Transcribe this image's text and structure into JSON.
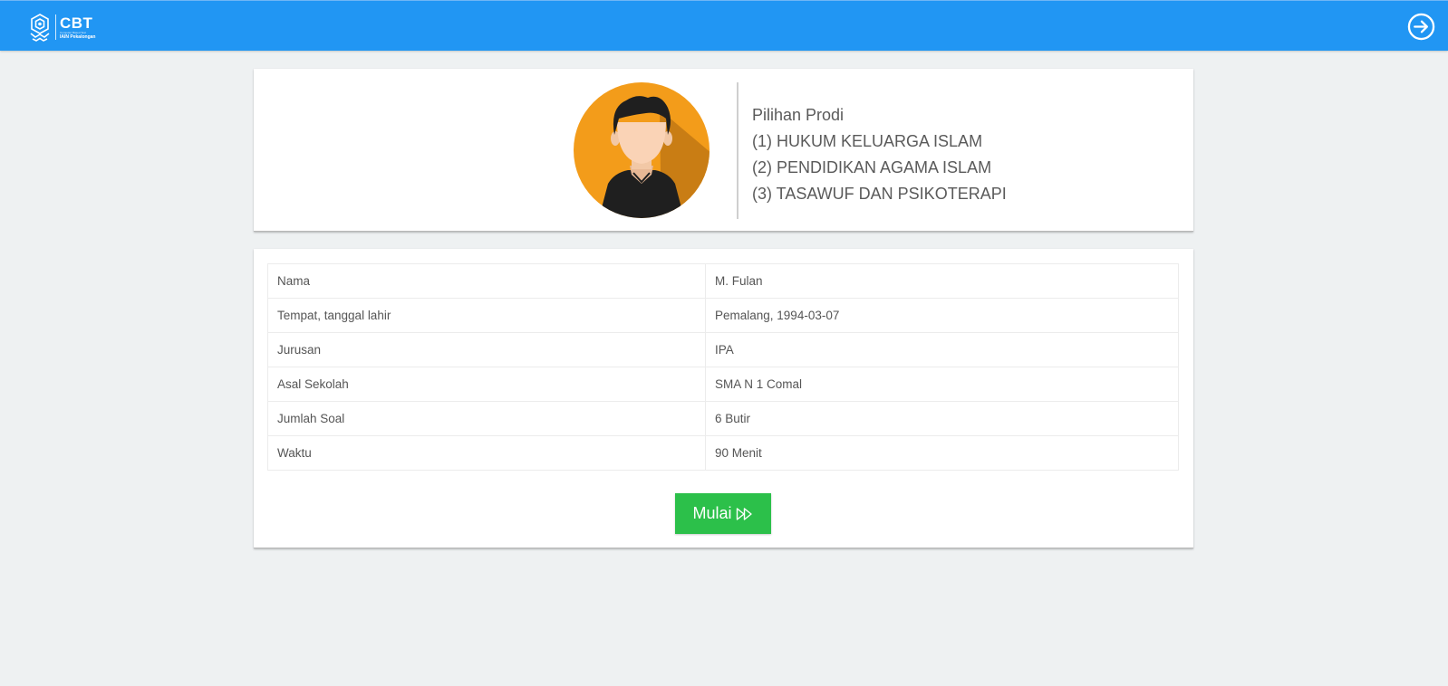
{
  "header": {
    "logo_title": "CBT",
    "logo_tagline": "Computer Based Test",
    "logo_subtitle": "IAIN Pekalongan",
    "logout_icon": "arrow-right-circle-icon"
  },
  "profile": {
    "avatar_icon": "user-avatar-icon",
    "prodi_title": "Pilihan Prodi",
    "prodi_list": [
      "(1) HUKUM KELUARGA ISLAM",
      "(2) PENDIDIKAN AGAMA ISLAM",
      "(3) TASAWUF DAN PSIKOTERAPI"
    ]
  },
  "info": {
    "rows": [
      {
        "label": "Nama",
        "value": "M. Fulan"
      },
      {
        "label": "Tempat, tanggal lahir",
        "value": "Pemalang, 1994-03-07"
      },
      {
        "label": "Jurusan",
        "value": "IPA"
      },
      {
        "label": "Asal Sekolah",
        "value": "SMA N 1 Comal"
      },
      {
        "label": "Jumlah Soal",
        "value": "6 Butir"
      },
      {
        "label": "Waktu",
        "value": "90 Menit"
      }
    ]
  },
  "actions": {
    "start_label": "Mulai",
    "start_icon": "fast-forward-icon"
  },
  "colors": {
    "header": "#2196f3",
    "start_button": "#2cc04a",
    "avatar_bg": "#f39c1a",
    "background": "#eef1f2"
  }
}
